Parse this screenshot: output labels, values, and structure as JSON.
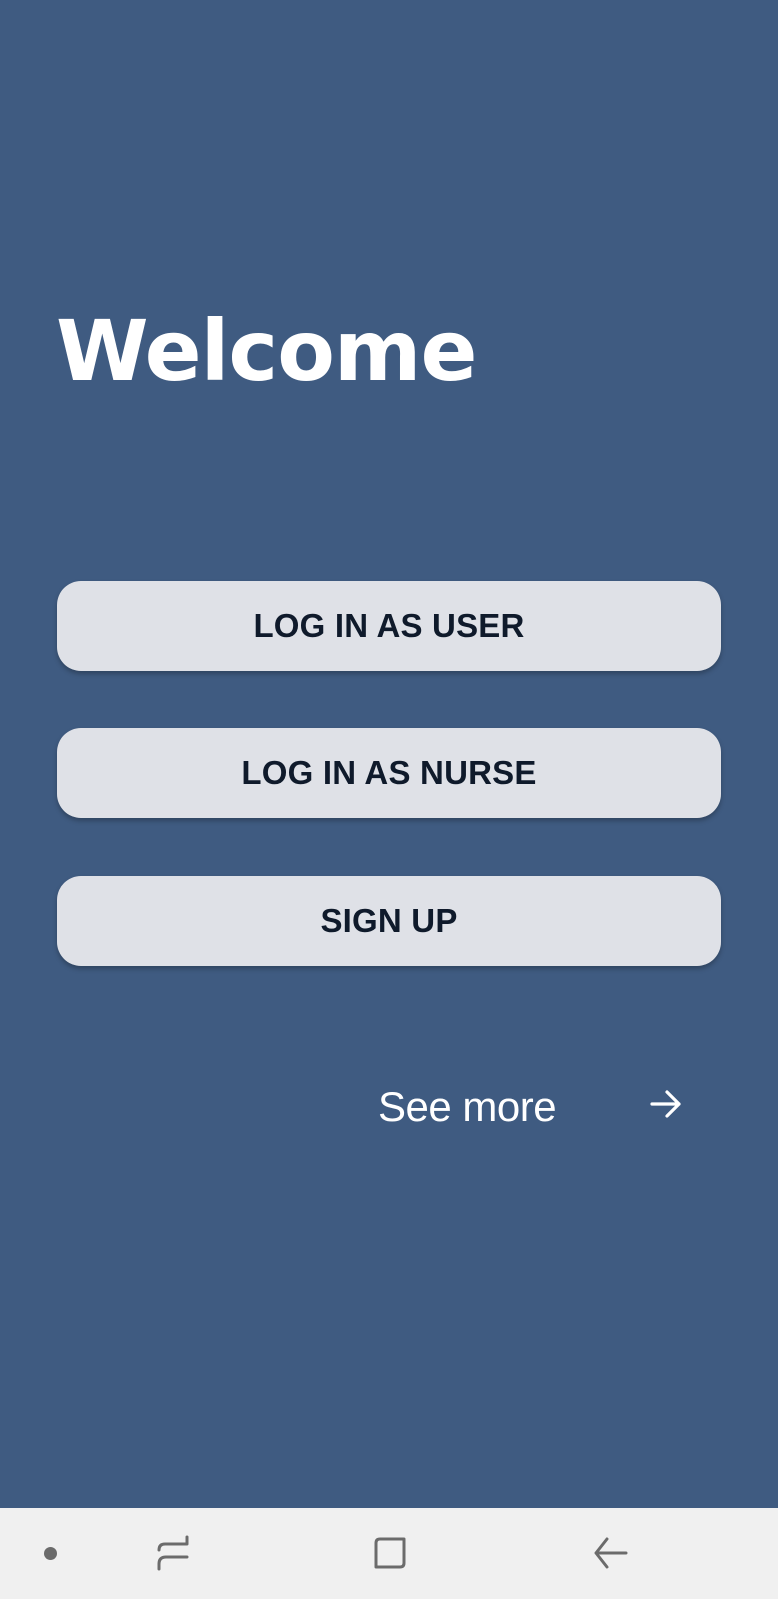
{
  "screen": {
    "background_color": "#3f5b81",
    "title": "Welcome"
  },
  "buttons": {
    "login_user": "LOG IN AS USER",
    "login_nurse": "LOG IN AS NURSE",
    "sign_up": "SIGN UP",
    "button_color": "#dfe1e7",
    "button_text_color": "#0f1a2b"
  },
  "see_more": {
    "label": "See more",
    "icon": "arrow-right-icon"
  },
  "system_nav": {
    "background_color": "#f0f0f0",
    "icons": [
      "nav-dot-icon",
      "recent-apps-icon",
      "home-icon",
      "back-icon"
    ]
  }
}
